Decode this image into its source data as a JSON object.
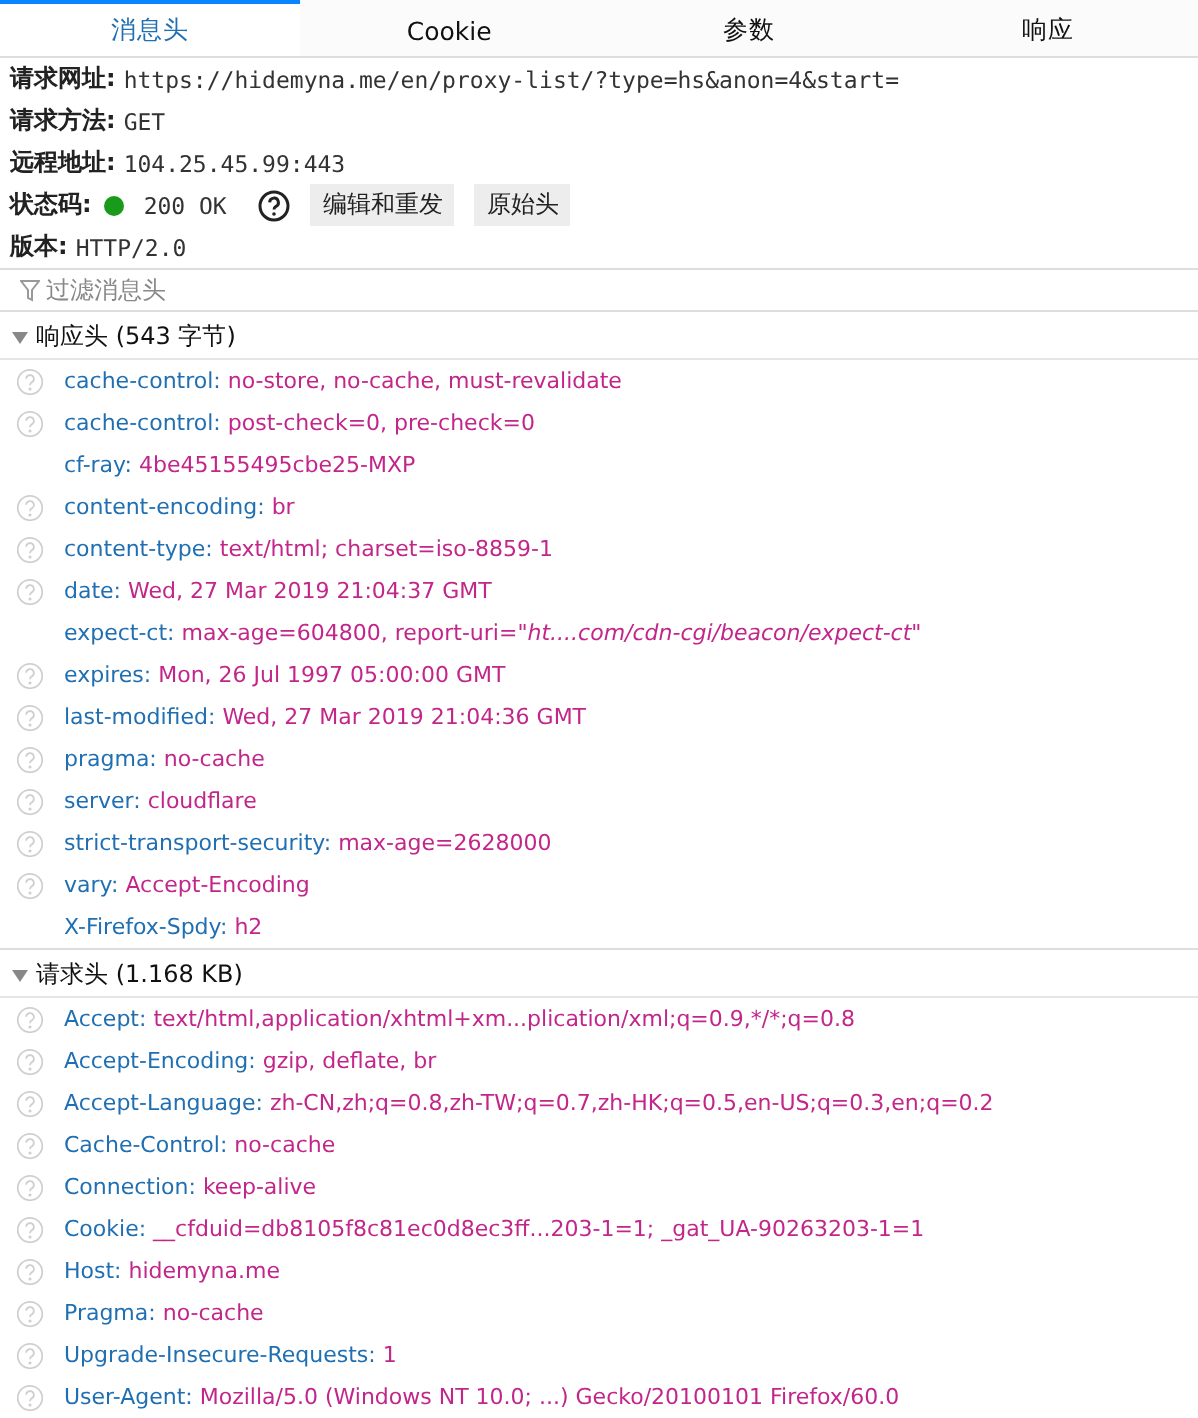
{
  "tabs": [
    {
      "label": "消息头",
      "selected": true
    },
    {
      "label": "Cookie",
      "selected": false
    },
    {
      "label": "参数",
      "selected": false
    },
    {
      "label": "响应",
      "selected": false
    }
  ],
  "summary": {
    "url": {
      "label": "请求网址:",
      "value": "https://hidemyna.me/en/proxy-list/?type=hs&anon=4&start="
    },
    "method": {
      "label": "请求方法:",
      "value": "GET"
    },
    "remote": {
      "label": "远程地址:",
      "value": "104.25.45.99:443"
    },
    "status": {
      "label": "状态码:",
      "color": "#1a9a1a",
      "value": "200 OK",
      "buttons": [
        "编辑和重发",
        "原始头"
      ]
    },
    "version": {
      "label": "版本:",
      "value": "HTTP/2.0"
    }
  },
  "filter": {
    "placeholder": "过滤消息头"
  },
  "sections": [
    {
      "title": "响应头 (543 字节)",
      "expanded": true,
      "headers": [
        {
          "name": "cache-control:",
          "value": "no-store, no-cache, must-revalidate",
          "help": true
        },
        {
          "name": "cache-control:",
          "value": "post-check=0, pre-check=0",
          "help": true
        },
        {
          "name": "cf-ray:",
          "value": "4be45155495cbe25-MXP",
          "help": false
        },
        {
          "name": "content-encoding:",
          "value": "br",
          "help": true
        },
        {
          "name": "content-type:",
          "value": "text/html; charset=iso-8859-1",
          "help": true
        },
        {
          "name": "date:",
          "value": "Wed, 27 Mar 2019 21:04:37 GMT",
          "help": true
        },
        {
          "name": "expect-ct:",
          "value": "max-age=604800, report-uri=\"",
          "value_italic": "ht....com/cdn-cgi/beacon/expect-ct\"",
          "help": false
        },
        {
          "name": "expires:",
          "value": "Mon, 26 Jul 1997 05:00:00 GMT",
          "help": true
        },
        {
          "name": "last-modified:",
          "value": "Wed, 27 Mar 2019 21:04:36 GMT",
          "help": true
        },
        {
          "name": "pragma:",
          "value": "no-cache",
          "help": true
        },
        {
          "name": "server:",
          "value": "cloudflare",
          "help": true
        },
        {
          "name": "strict-transport-security:",
          "value": "max-age=2628000",
          "help": true
        },
        {
          "name": "vary:",
          "value": "Accept-Encoding",
          "help": true
        },
        {
          "name": "X-Firefox-Spdy:",
          "value": "h2",
          "help": false
        }
      ]
    },
    {
      "title": "请求头 (1.168 KB)",
      "expanded": true,
      "headers": [
        {
          "name": "Accept:",
          "value": "text/html,application/xhtml+xm...plication/xml;q=0.9,*/*;q=0.8",
          "help": true
        },
        {
          "name": "Accept-Encoding:",
          "value": "gzip, deflate, br",
          "help": true
        },
        {
          "name": "Accept-Language:",
          "value": "zh-CN,zh;q=0.8,zh-TW;q=0.7,zh-HK;q=0.5,en-US;q=0.3,en;q=0.2",
          "help": true
        },
        {
          "name": "Cache-Control:",
          "value": "no-cache",
          "help": true
        },
        {
          "name": "Connection:",
          "value": "keep-alive",
          "help": true
        },
        {
          "name": "Cookie:",
          "value": "__cfduid=db8105f8c81ec0d8ec3ff...203-1=1; _gat_UA-90263203-1=1",
          "help": true
        },
        {
          "name": "Host:",
          "value": "hidemyna.me",
          "help": true
        },
        {
          "name": "Pragma:",
          "value": "no-cache",
          "help": true
        },
        {
          "name": "Upgrade-Insecure-Requests:",
          "value": "1",
          "help": true
        },
        {
          "name": "User-Agent:",
          "value": "Mozilla/5.0 (Windows NT 10.0; ...) Gecko/20100101 Firefox/60.0",
          "help": true
        }
      ]
    }
  ]
}
